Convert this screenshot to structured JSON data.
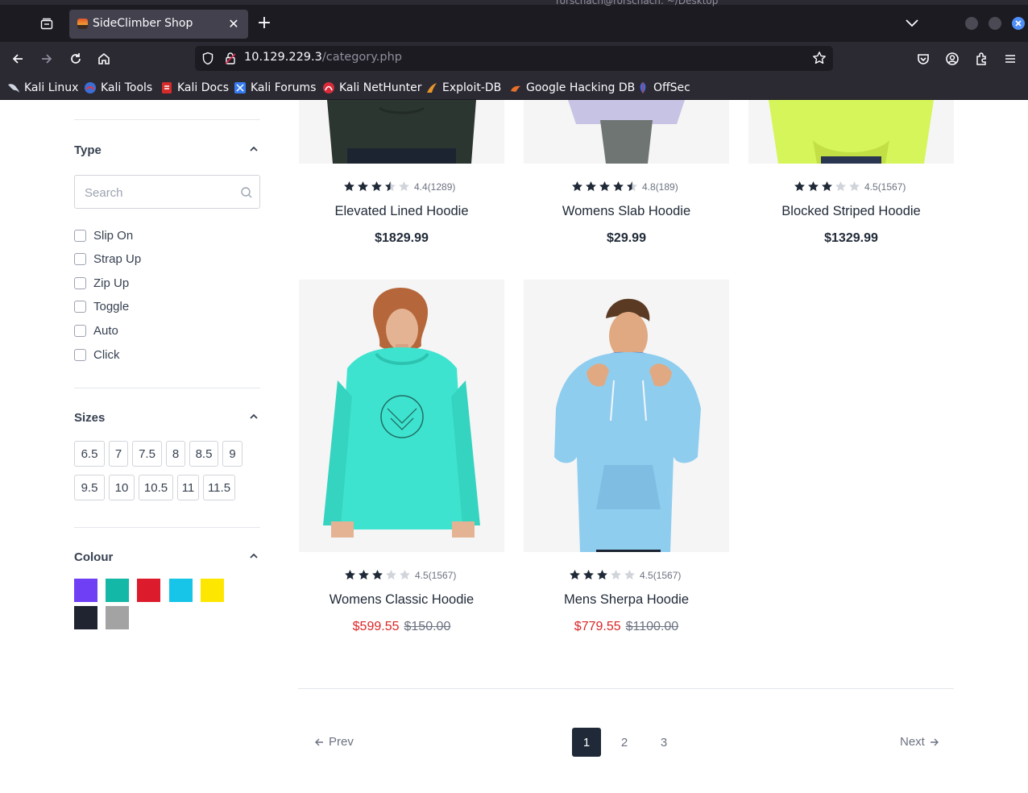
{
  "browser": {
    "window_title": "rorschach@rorschach: ~/Desktop",
    "tab_title": "SideClimber Shop",
    "url_host": "10.129.229.3",
    "url_path": "/category.php",
    "bookmarks": [
      {
        "label": "Kali Linux",
        "icon": "kali-dragon-icon"
      },
      {
        "label": "Kali Tools",
        "icon": "kali-tools-icon"
      },
      {
        "label": "Kali Docs",
        "icon": "kali-docs-icon"
      },
      {
        "label": "Kali Forums",
        "icon": "kali-forums-icon"
      },
      {
        "label": "Kali NetHunter",
        "icon": "kali-nethunter-icon"
      },
      {
        "label": "Exploit-DB",
        "icon": "exploit-db-icon"
      },
      {
        "label": "Google Hacking DB",
        "icon": "ghdb-icon"
      },
      {
        "label": "OffSec",
        "icon": "offsec-icon"
      }
    ]
  },
  "filters": {
    "type": {
      "title": "Type",
      "search_placeholder": "Search",
      "options": [
        "Slip On",
        "Strap Up",
        "Zip Up",
        "Toggle",
        "Auto",
        "Click"
      ]
    },
    "sizes": {
      "title": "Sizes",
      "options": [
        "6.5",
        "7",
        "7.5",
        "8",
        "8.5",
        "9",
        "9.5",
        "10",
        "10.5",
        "11",
        "11.5"
      ]
    },
    "colour": {
      "title": "Colour",
      "swatches": [
        "#6f3ff5",
        "#14b8a6",
        "#dc1c2c",
        "#16c5e8",
        "#fde700",
        "#1f2430",
        "#a3a3a3"
      ]
    }
  },
  "products": [
    {
      "name": "Elevated Lined Hoodie",
      "rating": "4.4",
      "reviews": "(1289)",
      "stars": 3.5,
      "price": "$1829.99",
      "sale": false,
      "old_price": ""
    },
    {
      "name": "Womens Slab Hoodie",
      "rating": "4.8",
      "reviews": "(189)",
      "stars": 4.5,
      "price": "$29.99",
      "sale": false,
      "old_price": ""
    },
    {
      "name": "Blocked Striped Hoodie",
      "rating": "4.5",
      "reviews": "(1567)",
      "stars": 3,
      "price": "$1329.99",
      "sale": false,
      "old_price": ""
    },
    {
      "name": "Womens Classic Hoodie",
      "rating": "4.5",
      "reviews": "(1567)",
      "stars": 3,
      "price": "$599.55",
      "sale": true,
      "old_price": "$150.00"
    },
    {
      "name": "Mens Sherpa Hoodie",
      "rating": "4.5",
      "reviews": "(1567)",
      "stars": 3,
      "price": "$779.55",
      "sale": true,
      "old_price": "$1100.00"
    }
  ],
  "pagination": {
    "prev_label": "Prev",
    "next_label": "Next",
    "pages": [
      "1",
      "2",
      "3"
    ],
    "current": "1"
  }
}
